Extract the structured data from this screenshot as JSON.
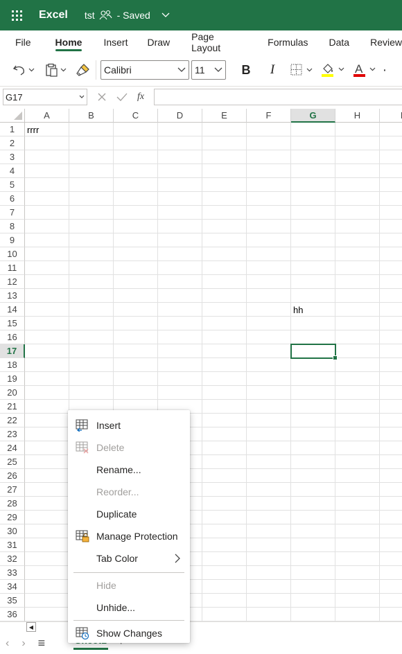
{
  "titlebar": {
    "app_name": "Excel",
    "doc_name": "tst",
    "save_status": "- Saved",
    "bg_color": "#217346"
  },
  "tabs": [
    {
      "label": "File"
    },
    {
      "label": "Home"
    },
    {
      "label": "Insert"
    },
    {
      "label": "Draw"
    },
    {
      "label": "Page Layout"
    },
    {
      "label": "Formulas"
    },
    {
      "label": "Data"
    },
    {
      "label": "Review"
    }
  ],
  "active_tab": "Home",
  "toolbar": {
    "font_name": "Calibri",
    "font_size": "11",
    "bold_label": "B",
    "italic_label": "I",
    "font_color_label": "A",
    "more_label": "·"
  },
  "formula_bar": {
    "name_box": "G17",
    "fx_label": "fx",
    "formula": ""
  },
  "grid": {
    "columns": [
      "A",
      "B",
      "C",
      "D",
      "E",
      "F",
      "G",
      "H",
      "I"
    ],
    "active_column": "G",
    "rows": [
      "1",
      "2",
      "3",
      "4",
      "5",
      "6",
      "7",
      "8",
      "9",
      "10",
      "11",
      "12",
      "13",
      "14",
      "15",
      "16",
      "17",
      "18",
      "19",
      "20",
      "21",
      "22",
      "23",
      "24",
      "25",
      "26",
      "27",
      "28",
      "29",
      "30",
      "31",
      "32",
      "33",
      "34",
      "35",
      "36"
    ],
    "active_row": "17",
    "cells": [
      {
        "ref": "A1",
        "value": "rrrr"
      },
      {
        "ref": "G14",
        "value": "hh"
      }
    ],
    "selected_cell": "G17"
  },
  "sheetbar": {
    "sheet_name": "Sheet1",
    "add_label": "+",
    "menu_label": "≡"
  },
  "context_menu": {
    "items": [
      {
        "label": "Insert",
        "icon": "insert-sheet-icon",
        "disabled": false
      },
      {
        "label": "Delete",
        "icon": "delete-sheet-icon",
        "disabled": true
      },
      {
        "label": "Rename...",
        "icon": "",
        "disabled": false
      },
      {
        "label": "Reorder...",
        "icon": "",
        "disabled": true
      },
      {
        "label": "Duplicate",
        "icon": "",
        "disabled": false
      },
      {
        "label": "Manage Protection",
        "icon": "protect-sheet-icon",
        "disabled": false
      },
      {
        "label": "Tab Color",
        "icon": "",
        "disabled": false,
        "submenu": true
      },
      {
        "label": "Hide",
        "icon": "",
        "disabled": true
      },
      {
        "label": "Unhide...",
        "icon": "",
        "disabled": false
      },
      {
        "label": "Show Changes",
        "icon": "show-changes-icon",
        "disabled": false
      }
    ]
  },
  "colors": {
    "accent": "#217346",
    "highlight_yellow": "#ffff00",
    "font_red": "#e00000"
  }
}
